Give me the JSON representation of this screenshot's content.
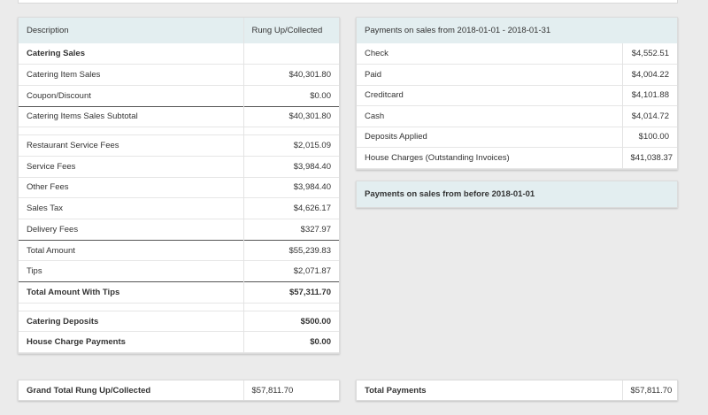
{
  "left_table": {
    "headers": [
      "Description",
      "Rung Up/Collected"
    ],
    "rows": [
      {
        "label": "Catering Sales",
        "value": "",
        "style": "bold"
      },
      {
        "label": "Catering Item Sales",
        "value": "$40,301.80",
        "style": ""
      },
      {
        "label": "Coupon/Discount",
        "value": "$0.00",
        "style": "thick"
      },
      {
        "label": "Catering Items Sales Subtotal",
        "value": "$40,301.80",
        "style": ""
      },
      {
        "label": "",
        "value": "",
        "style": "spacer"
      },
      {
        "label": "Restaurant Service Fees",
        "value": "$2,015.09",
        "style": ""
      },
      {
        "label": "Service Fees",
        "value": "$3,984.40",
        "style": ""
      },
      {
        "label": "Other Fees",
        "value": "$3,984.40",
        "style": ""
      },
      {
        "label": "Sales Tax",
        "value": "$4,626.17",
        "style": ""
      },
      {
        "label": "Delivery Fees",
        "value": "$327.97",
        "style": "thick"
      },
      {
        "label": "Total Amount",
        "value": "$55,239.83",
        "style": ""
      },
      {
        "label": "Tips",
        "value": "$2,071.87",
        "style": "thick"
      },
      {
        "label": "Total Amount With Tips",
        "value": "$57,311.70",
        "style": "bold"
      },
      {
        "label": "",
        "value": "",
        "style": "spacer"
      },
      {
        "label": "Catering Deposits",
        "value": "$500.00",
        "style": "bold"
      },
      {
        "label": "House Charge Payments",
        "value": "$0.00",
        "style": "bold"
      }
    ]
  },
  "payments_current": {
    "title": "Payments on sales from 2018-01-01 - 2018-01-31",
    "rows": [
      {
        "label": "Check",
        "value": "$4,552.51"
      },
      {
        "label": "Paid",
        "value": "$4,004.22"
      },
      {
        "label": "Creditcard",
        "value": "$4,101.88"
      },
      {
        "label": "Cash",
        "value": "$4,014.72"
      },
      {
        "label": "Deposits Applied",
        "value": "$100.00"
      },
      {
        "label": "House Charges (Outstanding Invoices)",
        "value": "$41,038.37"
      }
    ]
  },
  "payments_before": {
    "title": "Payments on sales from before 2018-01-01"
  },
  "grand_total": {
    "label": "Grand Total Rung Up/Collected",
    "value": "$57,811.70"
  },
  "total_payments": {
    "label": "Total Payments",
    "value": "$57,811.70"
  }
}
